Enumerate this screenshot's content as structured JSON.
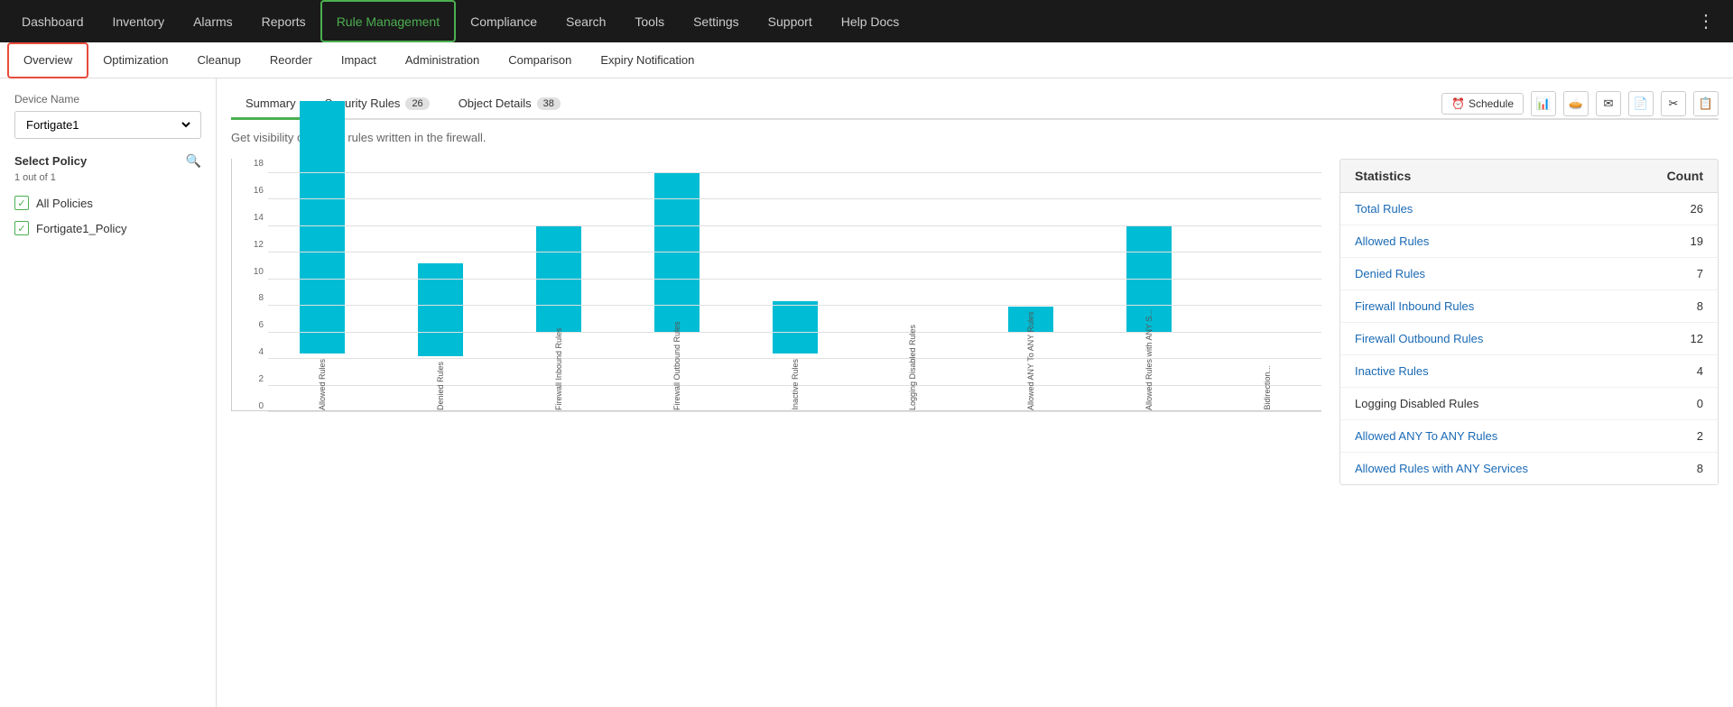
{
  "topNav": {
    "items": [
      {
        "label": "Dashboard",
        "active": false
      },
      {
        "label": "Inventory",
        "active": false
      },
      {
        "label": "Alarms",
        "active": false
      },
      {
        "label": "Reports",
        "active": false
      },
      {
        "label": "Rule Management",
        "active": true
      },
      {
        "label": "Compliance",
        "active": false
      },
      {
        "label": "Search",
        "active": false
      },
      {
        "label": "Tools",
        "active": false
      },
      {
        "label": "Settings",
        "active": false
      },
      {
        "label": "Support",
        "active": false
      },
      {
        "label": "Help Docs",
        "active": false
      }
    ]
  },
  "subNav": {
    "items": [
      {
        "label": "Overview",
        "active": true
      },
      {
        "label": "Optimization",
        "active": false
      },
      {
        "label": "Cleanup",
        "active": false
      },
      {
        "label": "Reorder",
        "active": false
      },
      {
        "label": "Impact",
        "active": false
      },
      {
        "label": "Administration",
        "active": false
      },
      {
        "label": "Comparison",
        "active": false
      },
      {
        "label": "Expiry Notification",
        "active": false
      }
    ]
  },
  "sidebar": {
    "deviceLabel": "Device Name",
    "deviceName": "Fortigate1",
    "selectPolicyLabel": "Select Policy",
    "policyCount": "1 out of 1",
    "policies": [
      {
        "label": "All Policies",
        "checked": true
      },
      {
        "label": "Fortigate1_Policy",
        "checked": true
      }
    ]
  },
  "tabs": {
    "items": [
      {
        "label": "Summary",
        "badge": null,
        "active": true
      },
      {
        "label": "Security Rules",
        "badge": "26",
        "active": false
      },
      {
        "label": "Object Details",
        "badge": "38",
        "active": false
      }
    ],
    "scheduleLabel": "Schedule"
  },
  "subtitle": "Get visibility on all the rules written in the firewall.",
  "chart": {
    "yLabels": [
      "0",
      "2",
      "4",
      "6",
      "8",
      "10",
      "12",
      "14",
      "16",
      "18"
    ],
    "maxValue": 19,
    "bars": [
      {
        "label": "Allowed Rules",
        "value": 19
      },
      {
        "label": "Denied Rules",
        "value": 7
      },
      {
        "label": "Firewall Inbound Rules",
        "value": 8
      },
      {
        "label": "Firewall Outbound Rules",
        "value": 12
      },
      {
        "label": "Inactive Rules",
        "value": 4
      },
      {
        "label": "Logging Disabled Rules",
        "value": 0
      },
      {
        "label": "Allowed ANY To ANY Rules",
        "value": 2
      },
      {
        "label": "Allowed Rules with ANY S...",
        "value": 8
      },
      {
        "label": "Bidirection...",
        "value": 0
      }
    ]
  },
  "statistics": {
    "headers": [
      "Statistics",
      "Count"
    ],
    "rows": [
      {
        "label": "Total Rules",
        "count": "26",
        "isLink": true
      },
      {
        "label": "Allowed Rules",
        "count": "19",
        "isLink": true
      },
      {
        "label": "Denied Rules",
        "count": "7",
        "isLink": true
      },
      {
        "label": "Firewall Inbound Rules",
        "count": "8",
        "isLink": true
      },
      {
        "label": "Firewall Outbound Rules",
        "count": "12",
        "isLink": true
      },
      {
        "label": "Inactive Rules",
        "count": "4",
        "isLink": true
      },
      {
        "label": "Logging Disabled Rules",
        "count": "0",
        "isLink": false
      },
      {
        "label": "Allowed ANY To ANY Rules",
        "count": "2",
        "isLink": true
      },
      {
        "label": "Allowed Rules with ANY Services",
        "count": "8",
        "isLink": true
      }
    ]
  }
}
